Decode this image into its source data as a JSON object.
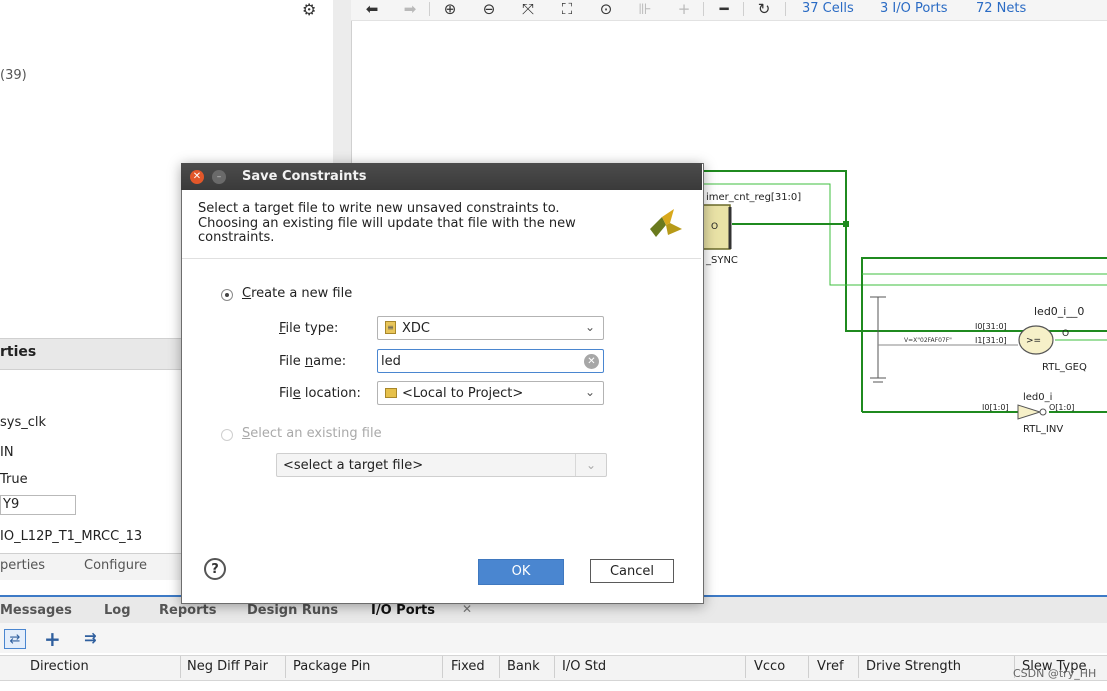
{
  "left_panel": {
    "partial_count": "(39)",
    "properties_title": "rties",
    "props": [
      "sys_clk",
      "IN",
      "True",
      "Y9",
      "IO_L12P_T1_MRCC_13"
    ],
    "tabs": [
      "perties",
      "Configure"
    ]
  },
  "toolbar": {
    "cells": "37 Cells",
    "io_ports": "3 I/O Ports",
    "nets": "72 Nets"
  },
  "schematic": {
    "reg_label": "imer_cnt_reg[31:0]",
    "sync_label": "_SYNC",
    "reg_out": "O",
    "geq_inst": "led0_i__0",
    "geq_type": "RTL_GEQ",
    "geq_op": ">=",
    "geq_in0": "I0[31:0]",
    "geq_in1": "I1[31:0]",
    "geq_out": "O",
    "const_label": "V=X\"02FAF07F\"",
    "inv_inst": "led0_i",
    "inv_type": "RTL_INV",
    "inv_in": "I0[1:0]",
    "inv_out": "O[1:0]"
  },
  "dialog": {
    "title": "Save Constraints",
    "description": "Select a target file to write new unsaved constraints to. Choosing an existing file will update that file with the new constraints.",
    "create_new": {
      "pre": "",
      "ul": "C",
      "rest": "reate a new file"
    },
    "file_type_label": {
      "pre": "",
      "ul": "F",
      "rest": "ile type:"
    },
    "file_type_value": "XDC",
    "file_name_label": {
      "pre": "File ",
      "ul": "n",
      "rest": "ame:"
    },
    "file_name_value": "led",
    "file_location_label": {
      "pre": "Fil",
      "ul": "e",
      "rest": " location:"
    },
    "file_location_value": "<Local to Project>",
    "select_existing": {
      "pre": "",
      "ul": "S",
      "rest": "elect an existing file"
    },
    "existing_placeholder": "<select a target file>",
    "help": "?",
    "ok": "OK",
    "cancel": "Cancel"
  },
  "bottom": {
    "tabs": [
      "Messages",
      "Log",
      "Reports",
      "Design Runs",
      "I/O Ports"
    ],
    "columns": [
      "Direction",
      "Neg Diff Pair",
      "Package Pin",
      "Fixed",
      "Bank",
      "I/O Std",
      "Vcco",
      "Vref",
      "Drive Strength",
      "Slew Type"
    ]
  },
  "watermark": "CSDN @try_HH"
}
